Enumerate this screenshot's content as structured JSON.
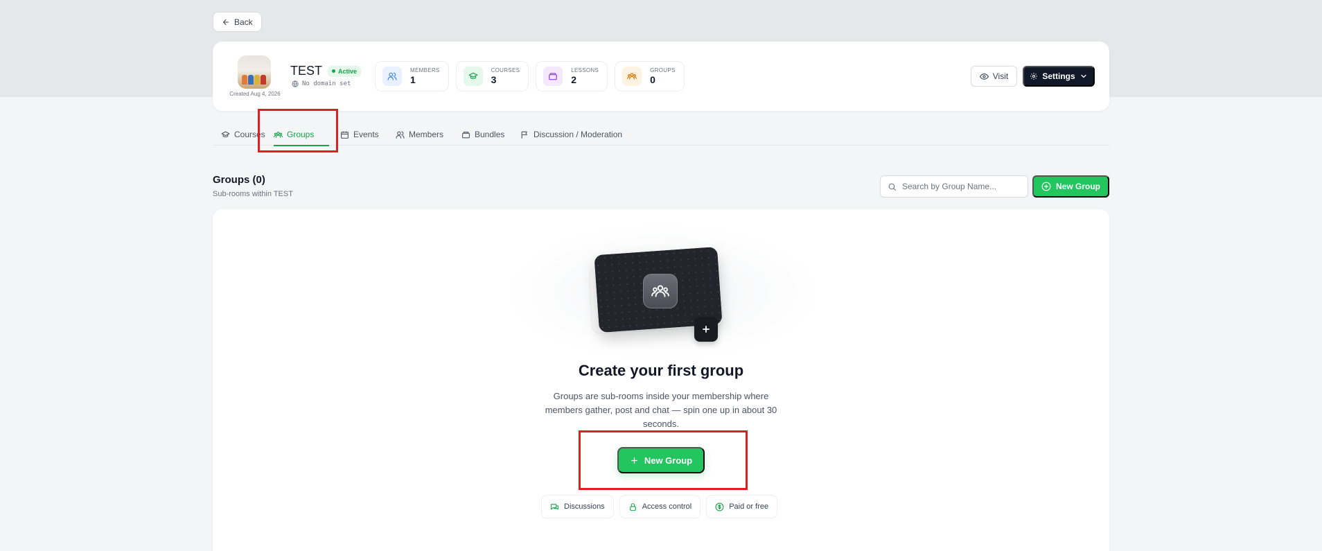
{
  "back_label": "Back",
  "membership": {
    "name": "TEST",
    "status": "Active",
    "domain": "No domain set",
    "created": "Created Aug 4, 2026"
  },
  "stats": [
    {
      "label": "MEMBERS",
      "value": "1",
      "icon": "users-icon",
      "color": "#3b82f6",
      "bg": "#eaf1fe"
    },
    {
      "label": "COURSES",
      "value": "3",
      "icon": "graduation-cap-icon",
      "color": "#16a34a",
      "bg": "#e6f7ec"
    },
    {
      "label": "LESSONS",
      "value": "2",
      "icon": "book-icon",
      "color": "#9333ea",
      "bg": "#f3e8fd"
    },
    {
      "label": "GROUPS",
      "value": "0",
      "icon": "group-icon",
      "color": "#d97706",
      "bg": "#fdf3e2"
    }
  ],
  "header_actions": {
    "visit": "Visit",
    "settings": "Settings"
  },
  "tabs": [
    {
      "label": "Courses",
      "icon": "graduation-cap-icon"
    },
    {
      "label": "Groups",
      "icon": "group-icon",
      "active": true
    },
    {
      "label": "Events",
      "icon": "calendar-icon"
    },
    {
      "label": "Members",
      "icon": "users-icon"
    },
    {
      "label": "Bundles",
      "icon": "package-icon"
    },
    {
      "label": "Discussion / Moderation",
      "icon": "flag-icon"
    }
  ],
  "section": {
    "title": "Groups (0)",
    "subtitle": "Sub-rooms within TEST",
    "search_placeholder": "Search by Group Name...",
    "new_group": "New Group"
  },
  "empty_state": {
    "title": "Create your first group",
    "description": "Groups are sub-rooms inside your membership where members gather, post and chat — spin one up in about 30 seconds.",
    "button": "New Group",
    "chips": [
      {
        "label": "Discussions",
        "icon": "chat-icon"
      },
      {
        "label": "Access control",
        "icon": "lock-icon"
      },
      {
        "label": "Paid or free",
        "icon": "dollar-icon"
      }
    ]
  },
  "colors": {
    "accent": "#22c55e",
    "dark": "#111827",
    "highlight": "#e02020"
  }
}
